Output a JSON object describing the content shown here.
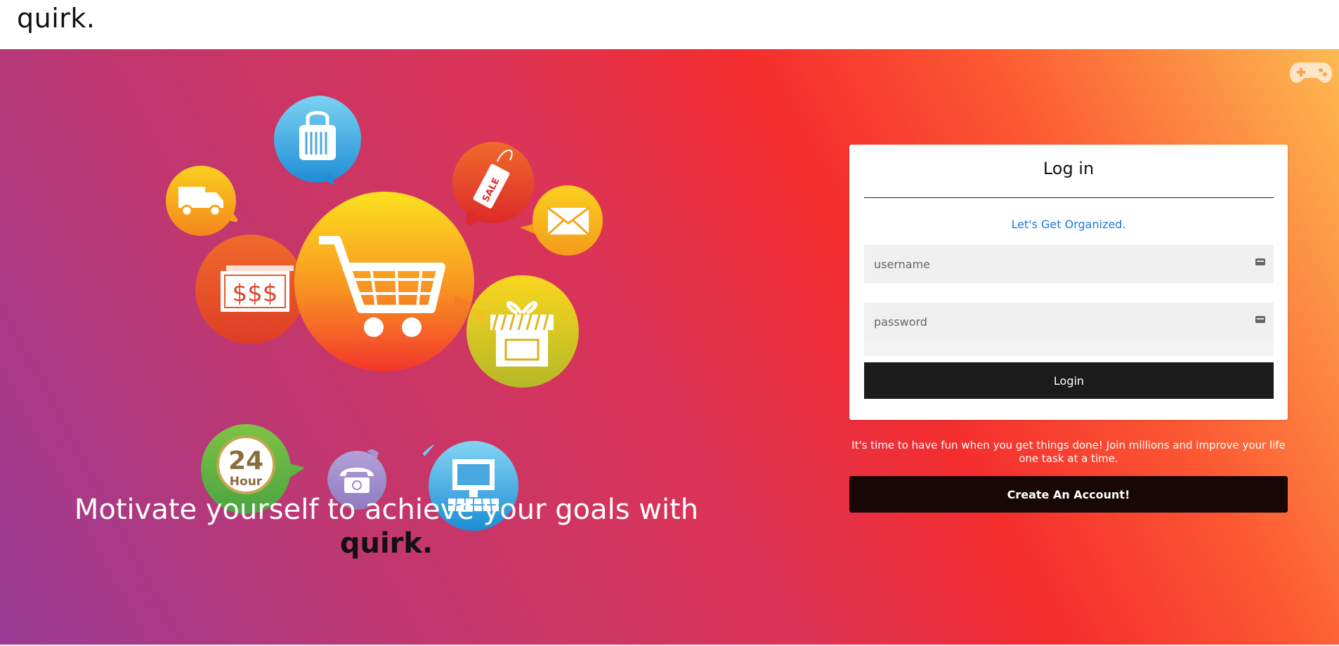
{
  "header": {
    "brand": "quirk."
  },
  "hero": {
    "tagline": "Motivate yourself to achieve your goals with",
    "tagline_brand": "quirk.",
    "illustration": {
      "sale_tag": "SALE",
      "money": "$$$",
      "hours_number": "24",
      "hours_label": "Hour"
    }
  },
  "login": {
    "title": "Log in",
    "subtitle": "Let's Get Organized.",
    "username_placeholder": "username",
    "password_placeholder": "password",
    "submit_label": "Login"
  },
  "promo_text": "It's time to have fun when you get things done! Join millions and improve your life one task at a time.",
  "create_account_label": "Create An Account!",
  "icons": [
    "gamepad-icon",
    "shopping-bag-icon",
    "truck-icon",
    "sale-tag-icon",
    "envelope-icon",
    "cart-icon",
    "money-icon",
    "gift-icon",
    "clock-24-icon",
    "telephone-icon",
    "computer-icon",
    "keyboard-icon"
  ],
  "colors": {
    "accent_link": "#1e78e0",
    "button_dark": "#1b1b1b",
    "create_button": "#190707"
  }
}
